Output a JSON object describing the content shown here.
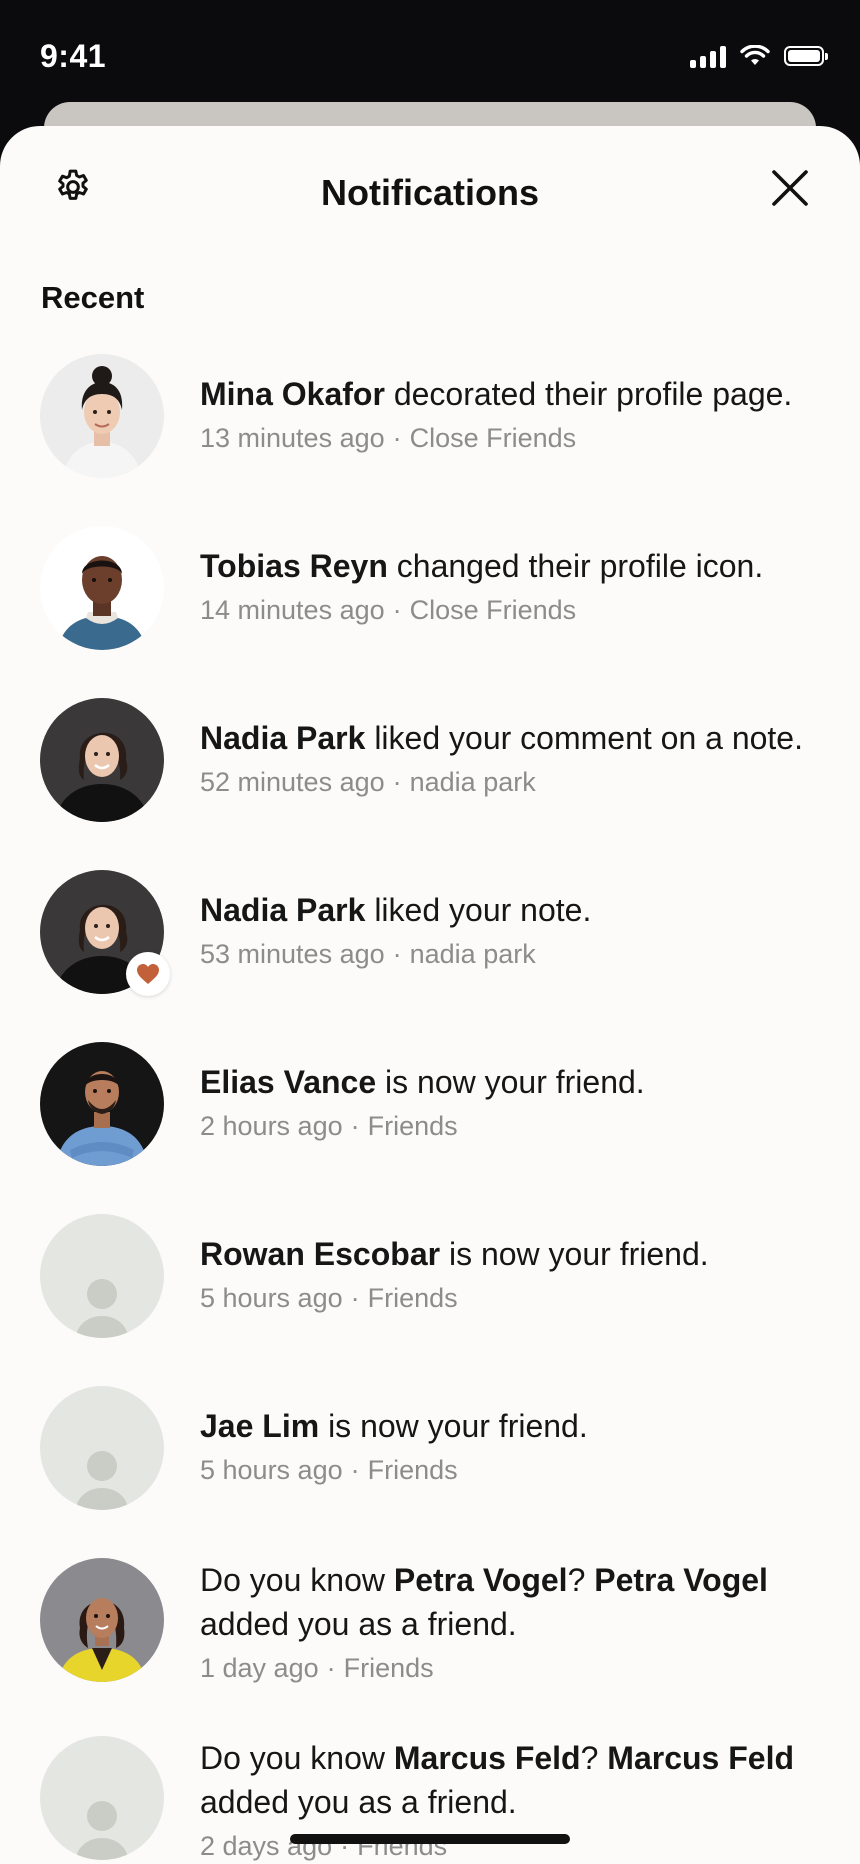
{
  "status_bar": {
    "time": "9:41"
  },
  "header": {
    "title": "Notifications"
  },
  "section": {
    "title": "Recent"
  },
  "notifications": [
    {
      "name": "Mina Okafor",
      "text": " decorated their profile page.",
      "time": "13 minutes ago",
      "context": "Close Friends",
      "avatar": "woman-bun"
    },
    {
      "name": "Tobias Reyn",
      "text": " changed their profile icon.",
      "time": "14 minutes ago",
      "context": "Close Friends",
      "avatar": "man-blue"
    },
    {
      "name": "Nadia Park",
      "text": " liked your comment on a note.",
      "time": "52 minutes ago",
      "context": "nadia park",
      "avatar": "woman-dark"
    },
    {
      "name": "Nadia Park",
      "text": " liked your note.",
      "time": "53 minutes ago",
      "context": "nadia park",
      "avatar": "woman-dark",
      "badge": "heart-icon"
    },
    {
      "name": "Elias Vance",
      "text": " is now your friend.",
      "time": "2 hours ago",
      "context": "Friends",
      "avatar": "man-arms"
    },
    {
      "name": "Rowan Escobar",
      "text": " is now your friend.",
      "time": "5 hours ago",
      "context": "Friends",
      "avatar": "placeholder"
    },
    {
      "name": "Jae Lim",
      "text": " is now your friend.",
      "time": "5 hours ago",
      "context": "Friends",
      "avatar": "placeholder"
    }
  ],
  "friend_requests": [
    {
      "prefix": "Do you know ",
      "name": "Petra Vogel",
      "mid": "? ",
      "name2": "Petra Vogel",
      "line2": "added you as a friend.",
      "time": "1 day ago",
      "context": "Friends",
      "avatar": "woman-yellow"
    },
    {
      "prefix": "Do you know ",
      "name": "Marcus Feld",
      "mid": "? ",
      "name2": "Marcus Feld",
      "line2": "added you as a friend.",
      "time": "2 days ago",
      "context": "Friends",
      "avatar": "placeholder"
    }
  ],
  "colors": {
    "sheet_bg": "#fcfbfa",
    "meta_text": "#8c8c8c",
    "heart": "#c2603a",
    "placeholder_bg": "#e4e6e1",
    "placeholder_fg": "#c9cdc5"
  }
}
